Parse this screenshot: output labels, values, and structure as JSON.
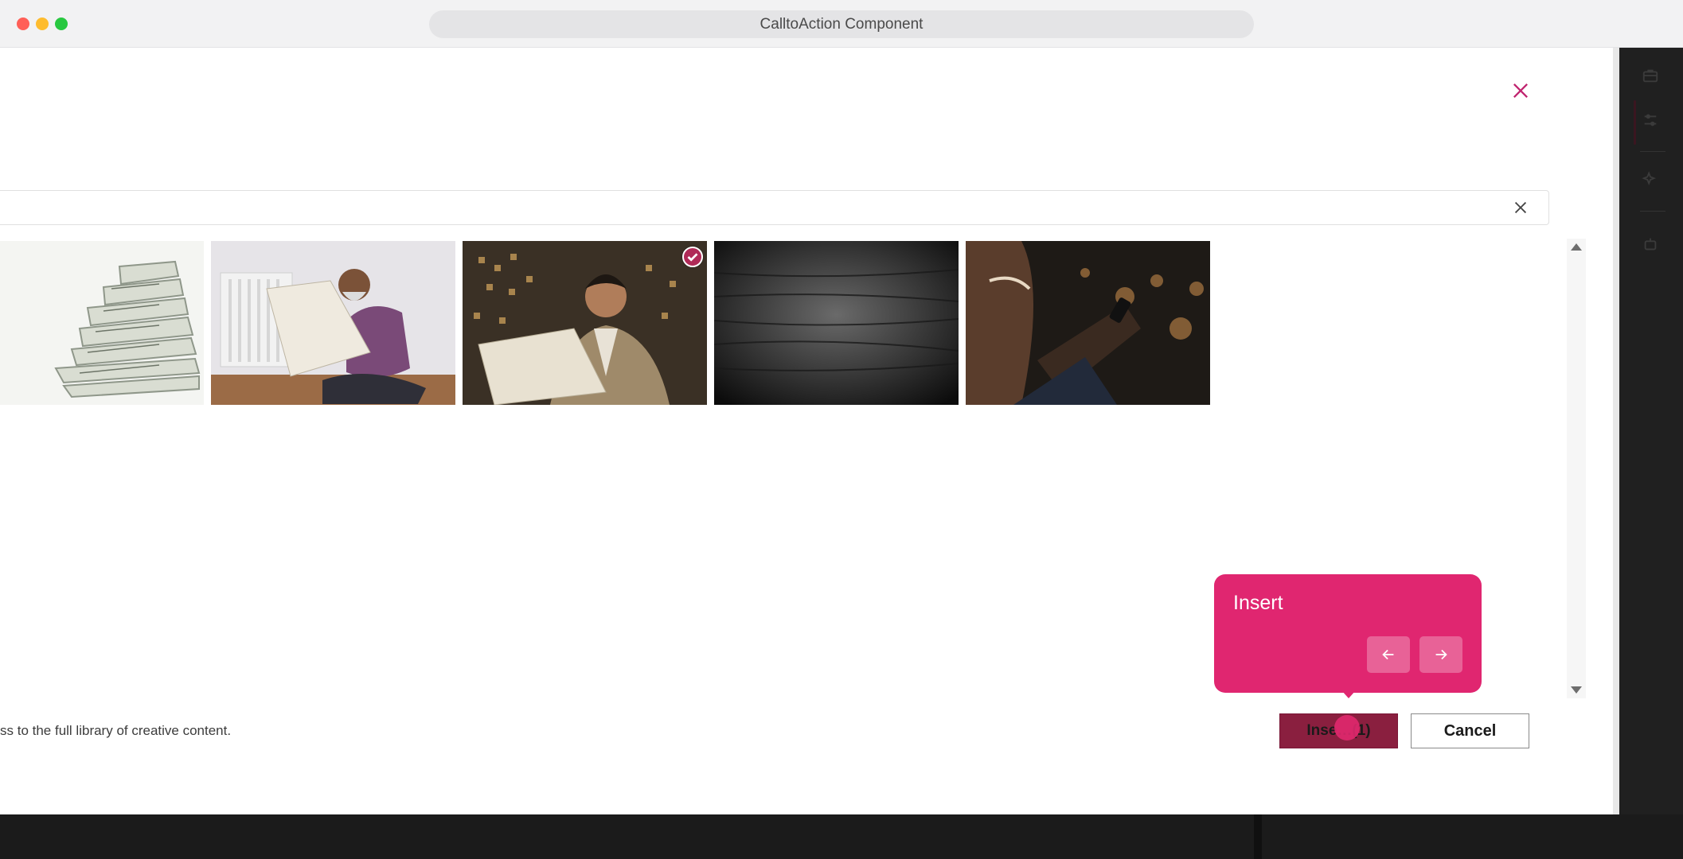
{
  "window": {
    "title": "CalltoAction Component"
  },
  "search": {
    "value": "",
    "placeholder": ""
  },
  "images": [
    {
      "subject": "stacked newspapers",
      "selected": false
    },
    {
      "subject": "man reading newspaper on floor",
      "selected": false
    },
    {
      "subject": "businessman reading newspaper",
      "selected": true
    },
    {
      "subject": "dark texture",
      "selected": false
    },
    {
      "subject": "person using phone at night",
      "selected": false
    }
  ],
  "footer": {
    "note": "ss to the full library of creative content."
  },
  "buttons": {
    "insert_label": "Inse…(1)",
    "cancel_label": "Cancel"
  },
  "tour": {
    "title": "Insert"
  },
  "icons": {
    "close": "close-icon",
    "clear": "clear-search-icon",
    "check": "check-icon",
    "prev": "arrow-left-icon",
    "next": "arrow-right-icon"
  },
  "colors": {
    "accent": "#e02670",
    "insert_button": "#8a1f3f",
    "close_icon": "#c0246f"
  }
}
